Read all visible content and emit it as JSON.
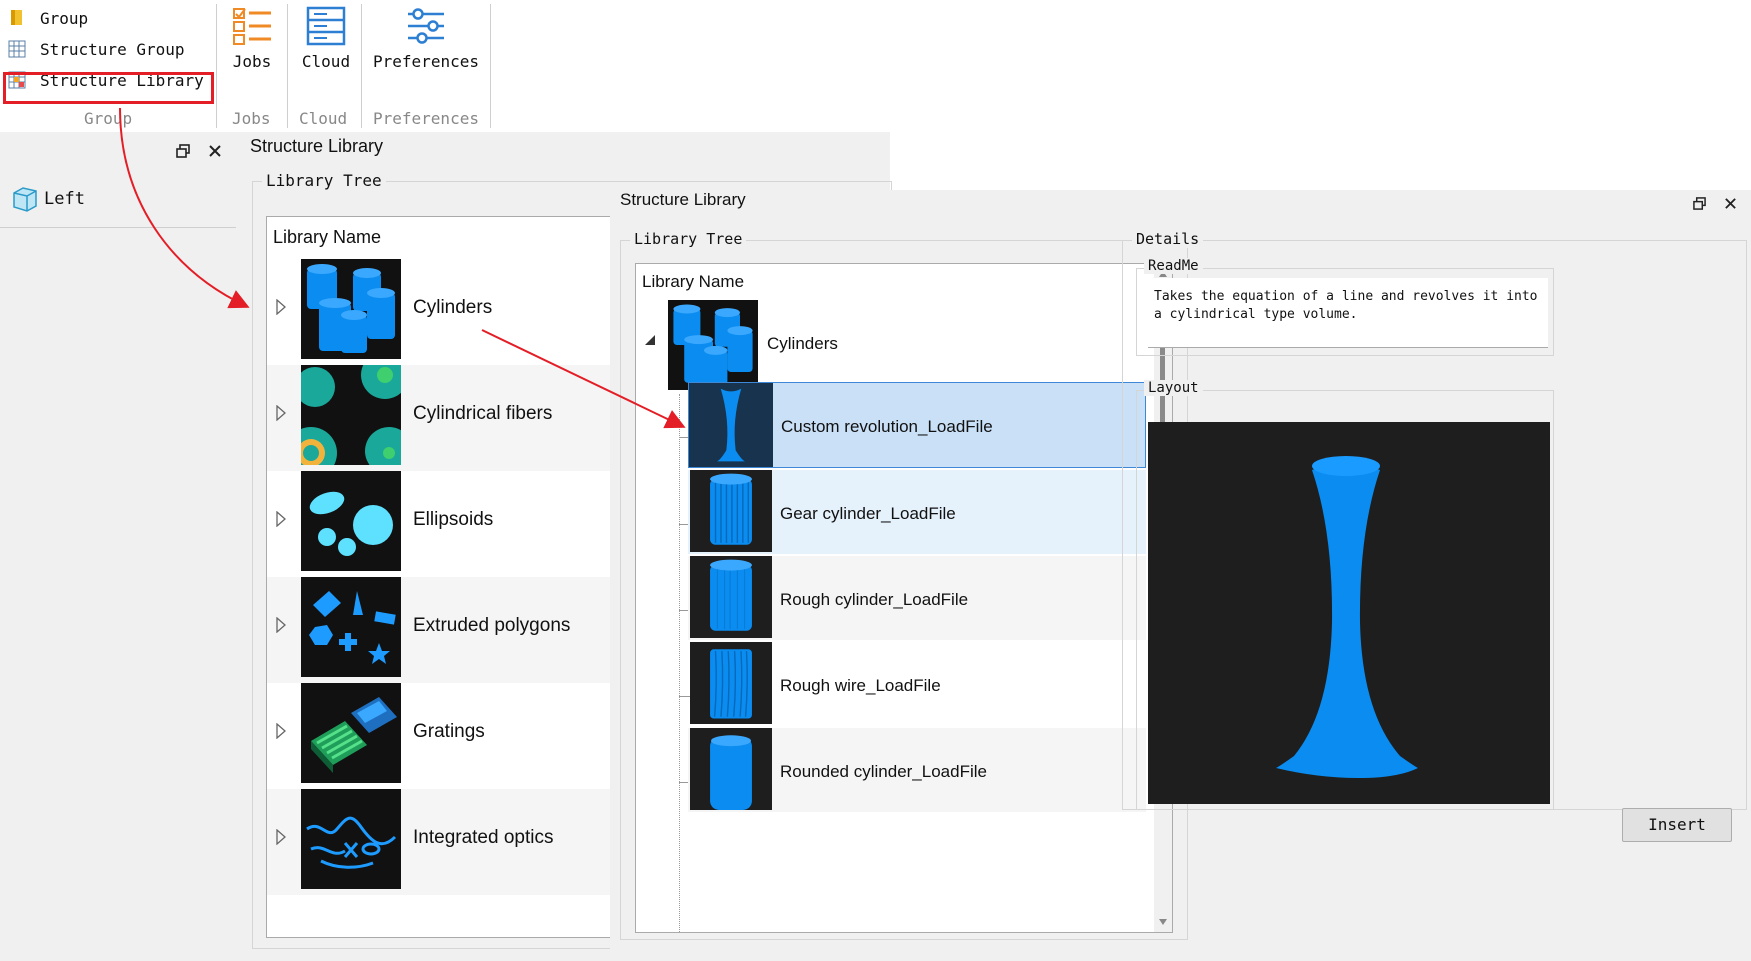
{
  "ribbon": {
    "items": [
      "Group",
      "Structure Group",
      "Structure Library"
    ],
    "buttons": [
      "Jobs",
      "Cloud",
      "Preferences"
    ],
    "group_labels": [
      "Group",
      "Jobs",
      "Cloud",
      "Preferences"
    ]
  },
  "left_panel": {
    "item_label": "Left"
  },
  "library_window_1": {
    "title": "Structure Library",
    "tree_group_label": "Library Tree",
    "header": "Library Name",
    "rows": [
      "Cylinders",
      "Cylindrical fibers",
      "Ellipsoids",
      "Extruded polygons",
      "Gratings",
      "Integrated optics"
    ]
  },
  "library_window_2": {
    "title": "Structure Library",
    "tree_group_label": "Library Tree",
    "header": "Library Name",
    "parent": "Cylinders",
    "children": [
      "Custom revolution_LoadFile",
      "Gear cylinder_LoadFile",
      "Rough cylinder_LoadFile",
      "Rough wire_LoadFile",
      "Rounded cylinder_LoadFile"
    ],
    "details_label": "Details",
    "readme_label": "ReadMe",
    "readme_text": "Takes the equation of a line and revolves it into a cylindrical type volume.",
    "layout_label": "Layout",
    "insert_button": "Insert"
  },
  "colors": {
    "accent_blue": "#0a8cf0",
    "highlight_red": "#e41e26",
    "selection": "#c9e0f7"
  }
}
